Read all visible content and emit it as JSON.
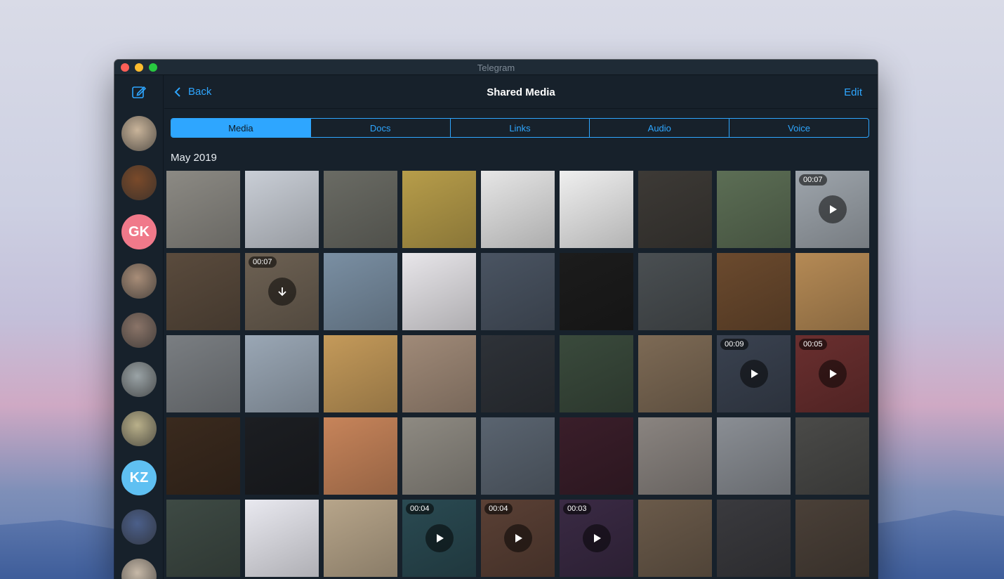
{
  "window": {
    "title": "Telegram"
  },
  "header": {
    "back_label": "Back",
    "title": "Shared Media",
    "edit_label": "Edit"
  },
  "tabs": [
    {
      "label": "Media",
      "active": true
    },
    {
      "label": "Docs",
      "active": false
    },
    {
      "label": "Links",
      "active": false
    },
    {
      "label": "Audio",
      "active": false
    },
    {
      "label": "Voice",
      "active": false
    }
  ],
  "section": {
    "title": "May 2019"
  },
  "sidebar": {
    "chats": [
      {
        "initials": "",
        "color": "#c9b49a"
      },
      {
        "initials": "",
        "color": "#7a4a2a"
      },
      {
        "initials": "GK",
        "color": "#f0798a"
      },
      {
        "initials": "",
        "color": "#a88d78"
      },
      {
        "initials": "",
        "color": "#8a7468"
      },
      {
        "initials": "",
        "color": "#9aa3a6"
      },
      {
        "initials": "",
        "color": "#b9b08a"
      },
      {
        "initials": "KZ",
        "color": "#5fc0f2"
      },
      {
        "initials": "",
        "color": "#4b5f8a"
      },
      {
        "initials": "",
        "color": "#c7b9a8"
      }
    ]
  },
  "media": [
    {
      "color": "#8c8a84",
      "duration": ""
    },
    {
      "color": "#c9ced6",
      "duration": ""
    },
    {
      "color": "#6a6b64",
      "duration": ""
    },
    {
      "color": "#b79d4a",
      "duration": ""
    },
    {
      "color": "#e6e6e6",
      "duration": ""
    },
    {
      "color": "#efefef",
      "duration": ""
    },
    {
      "color": "#3d3a36",
      "duration": ""
    },
    {
      "color": "#5c6e55",
      "duration": ""
    },
    {
      "color": "#9ea5ac",
      "duration": "00:07",
      "icon": "play"
    },
    {
      "color": "#5a4b3d",
      "duration": ""
    },
    {
      "color": "#6d6153",
      "duration": "00:07",
      "icon": "download"
    },
    {
      "color": "#7a8fa3",
      "duration": ""
    },
    {
      "color": "#e8e6ea",
      "duration": ""
    },
    {
      "color": "#4a5462",
      "duration": ""
    },
    {
      "color": "#1c1c1c",
      "duration": ""
    },
    {
      "color": "#4a4f52",
      "duration": ""
    },
    {
      "color": "#6b4a2e",
      "duration": ""
    },
    {
      "color": "#b58a55",
      "duration": ""
    },
    {
      "color": "#7a7e82",
      "duration": ""
    },
    {
      "color": "#9aa7b5",
      "duration": ""
    },
    {
      "color": "#c49a5a",
      "duration": ""
    },
    {
      "color": "#a08a78",
      "duration": ""
    },
    {
      "color": "#2e3238",
      "duration": ""
    },
    {
      "color": "#3a4a3c",
      "duration": ""
    },
    {
      "color": "#7d6a55",
      "duration": ""
    },
    {
      "color": "#3a4250",
      "duration": "00:09",
      "icon": "play"
    },
    {
      "color": "#6a2f2f",
      "duration": "00:05",
      "icon": "play"
    },
    {
      "color": "#3a2a1e",
      "duration": ""
    },
    {
      "color": "#1c1e22",
      "duration": ""
    },
    {
      "color": "#c7845a",
      "duration": ""
    },
    {
      "color": "#8e8a82",
      "duration": ""
    },
    {
      "color": "#5a6470",
      "duration": ""
    },
    {
      "color": "#3a1e2a",
      "duration": ""
    },
    {
      "color": "#8a8480",
      "duration": ""
    },
    {
      "color": "#8a8e94",
      "duration": ""
    },
    {
      "color": "#4a4a48",
      "duration": ""
    },
    {
      "color": "#3e4a44",
      "duration": ""
    },
    {
      "color": "#e9e9f0",
      "duration": ""
    },
    {
      "color": "#b7a58a",
      "duration": ""
    },
    {
      "color": "#2a4a52",
      "duration": "00:04",
      "icon": "play"
    },
    {
      "color": "#5a4035",
      "duration": "00:04",
      "icon": "play"
    },
    {
      "color": "#3a2a44",
      "duration": "00:03",
      "icon": "play"
    },
    {
      "color": "#6a5a4a",
      "duration": ""
    },
    {
      "color": "#3a3a3e",
      "duration": ""
    },
    {
      "color": "#4a4038",
      "duration": ""
    }
  ]
}
